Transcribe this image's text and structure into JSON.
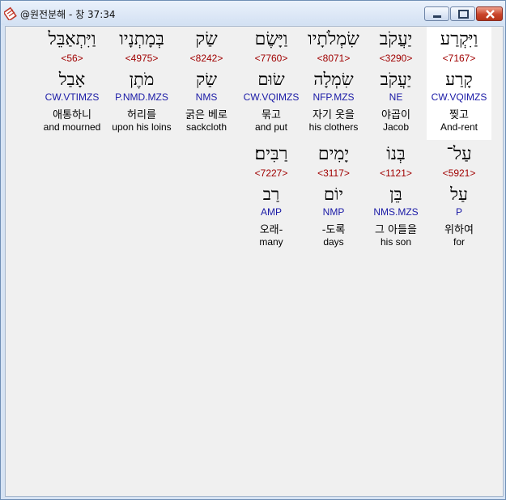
{
  "window": {
    "title": "@원전분해 - 창 37:34"
  },
  "colors": {
    "strong_number": "#a00000",
    "morphology": "#1a1aa6",
    "highlight": "#ffffff"
  },
  "rows": [
    {
      "words": [
        {
          "hebrew": "וַיִּקְרַע",
          "strong": "<7167>",
          "lemma": "קָרַע",
          "morph": "CW.VQIMZS",
          "korean": "찢고",
          "english": "And-rent",
          "highlighted": true
        },
        {
          "hebrew": "יַעֲקֹב",
          "strong": "<3290>",
          "lemma": "יַעֲקֹב",
          "morph": "NE",
          "korean": "야곱이",
          "english": "Jacob",
          "highlighted": false
        },
        {
          "hebrew": "שִׂמְלֹתָיו",
          "strong": "<8071>",
          "lemma": "שִׂמְלָה",
          "morph": "NFP.MZS",
          "korean": "자기 옷을",
          "english": "his clothers",
          "highlighted": false
        },
        {
          "hebrew": "וַיָּשֶׂם",
          "strong": "<7760>",
          "lemma": "שׂוּם",
          "morph": "CW.VQIMZS",
          "korean": "묶고",
          "english": "and put",
          "highlighted": false
        },
        {
          "hebrew": "שַׂק",
          "strong": "<8242>",
          "lemma": "שַׂק",
          "morph": "NMS",
          "korean": "굵은 베로",
          "english": "sackcloth",
          "highlighted": false
        },
        {
          "hebrew": "בְּמָתְנָיו",
          "strong": "<4975>",
          "lemma": "מֹתֶן",
          "morph": "P.NMD.MZS",
          "korean": "허리를",
          "english": "upon his loins",
          "highlighted": false
        },
        {
          "hebrew": "וַיִּתְאַבֵּל",
          "strong": "<56>",
          "lemma": "אָבַל",
          "morph": "CW.VTIMZS",
          "korean": "애통하니",
          "english": "and mourned",
          "highlighted": false
        }
      ]
    },
    {
      "words": [
        {
          "hebrew": "עַל־",
          "strong": "<5921>",
          "lemma": "עַל",
          "morph": "P",
          "korean": "위하여",
          "english": "for",
          "highlighted": false
        },
        {
          "hebrew": "בְּנוֹ",
          "strong": "<1121>",
          "lemma": "בֵּן",
          "morph": "NMS.MZS",
          "korean": "그 아들을",
          "english": "his son",
          "highlighted": false
        },
        {
          "hebrew": "יָמִים",
          "strong": "<3117>",
          "lemma": "יוֹם",
          "morph": "NMP",
          "korean": "-도록",
          "english": "days",
          "highlighted": false
        },
        {
          "hebrew": "רַבִּים׃",
          "strong": "<7227>",
          "lemma": "רַב",
          "morph": "AMP",
          "korean": "오래-",
          "english": "many",
          "highlighted": false
        }
      ]
    }
  ]
}
